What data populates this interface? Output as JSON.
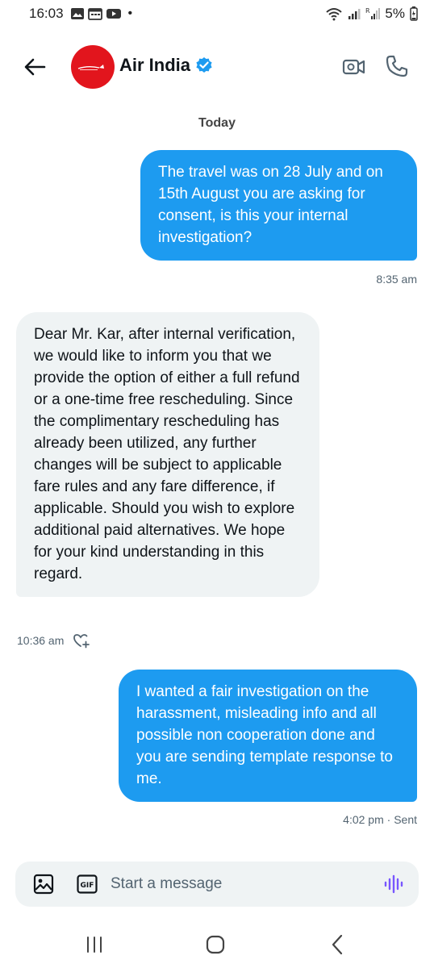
{
  "status_bar": {
    "time": "16:03",
    "battery": "5%",
    "icons": [
      "image-icon",
      "calendar-icon",
      "youtube-icon",
      "wifi-icon",
      "signal-icon",
      "signal-roaming-icon",
      "battery-icon"
    ]
  },
  "header": {
    "contact_name": "Air India",
    "verified": true,
    "icons": [
      "back-arrow-icon",
      "video-camera-icon",
      "phone-icon"
    ],
    "avatar_color": "#e2151d"
  },
  "conversation": {
    "day_label": "Today",
    "messages": [
      {
        "direction": "outgoing",
        "text": "The travel was on 28 July and on 15th August you are asking for consent, is this your internal investigation?",
        "time": "8:35 am"
      },
      {
        "direction": "incoming",
        "text": "Dear Mr. Kar, after internal verification, we would like to inform you that we provide the option of either a full refund or a one-time free rescheduling. Since the complimentary rescheduling has already been utilized, any further changes will be subject to applicable fare rules and any fare difference, if applicable. Should you wish to explore additional paid alternatives. We hope for your kind understanding in this regard.",
        "time": "10:36 am"
      },
      {
        "direction": "outgoing",
        "text": "I wanted a fair investigation on the harassment, misleading info and all possible non cooperation done and you are sending template response to me.",
        "time": "4:02 pm · Sent"
      }
    ]
  },
  "composer": {
    "placeholder": "Start a message",
    "value": "",
    "icons": [
      "image-icon",
      "gif-icon",
      "voice-waveform-icon"
    ]
  },
  "colors": {
    "accent": "#1d9bf0",
    "incoming_bubble": "#eff3f4",
    "voice_icon": "#7856ff"
  }
}
